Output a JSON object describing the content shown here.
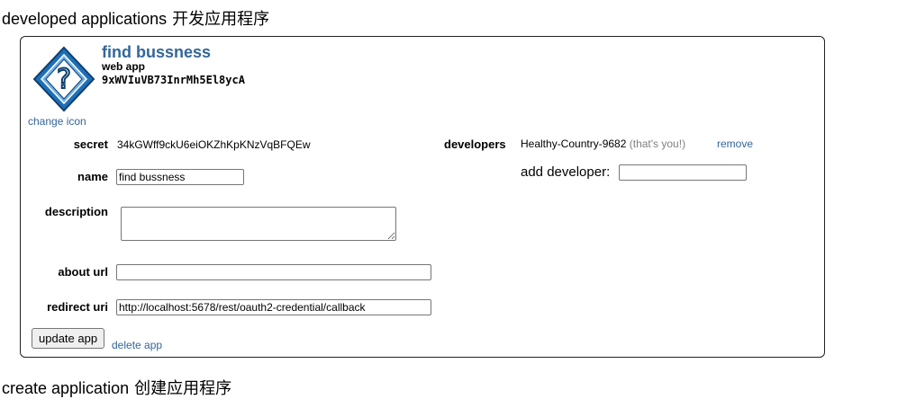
{
  "headings": {
    "developed": {
      "en": "developed applications",
      "cn": "开发应用程序"
    },
    "create": {
      "en": "create application",
      "cn": "创建应用程序"
    }
  },
  "app": {
    "name": "find bussness",
    "type": "web app",
    "client_id": "9xWVIuVB73InrMh5El8ycA",
    "icon": "question-mark-diamond-icon",
    "change_icon_label": "change icon",
    "secret_label": "secret",
    "secret_value": "34kGWff9ckU6eiOKZhKpKNzVqBFQEw",
    "name_label": "name",
    "name_value": "find bussness",
    "description_label": "description",
    "description_value": "",
    "about_url_label": "about url",
    "about_url_value": "",
    "redirect_uri_label": "redirect uri",
    "redirect_uri_value": "http://localhost:5678/rest/oauth2-credential/callback",
    "update_button_label": "update app",
    "delete_link_label": "delete app"
  },
  "developers": {
    "label": "developers",
    "name": "Healthy-Country-9682",
    "you_note": "(that's you!)",
    "remove_label": "remove",
    "add_label": "add developer:",
    "add_value": ""
  },
  "colors": {
    "link": "#336699",
    "icon_fill": "#1e6fb8",
    "muted": "#808080"
  }
}
